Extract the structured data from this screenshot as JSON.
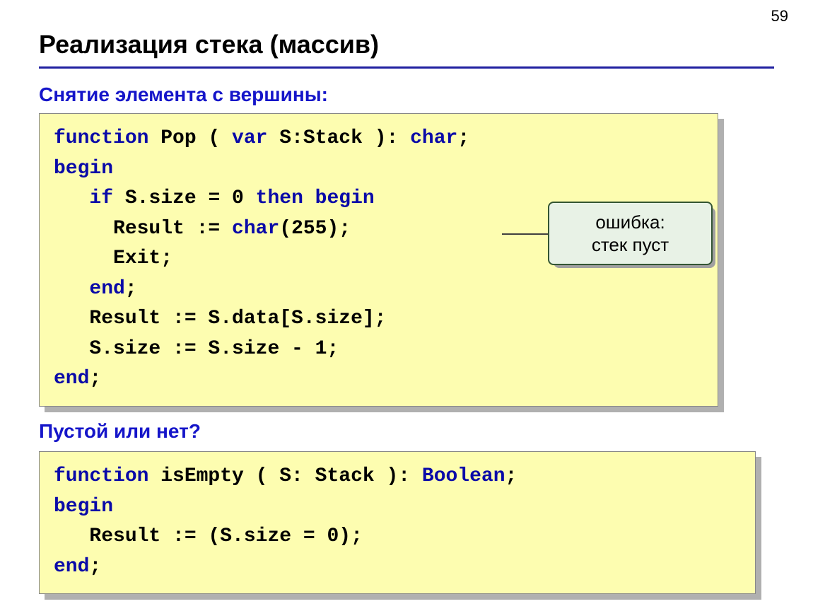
{
  "page_number": "59",
  "title": "Реализация стека (массив)",
  "subhead1": "Снятие элемента с вершины:",
  "subhead2": "Пустой или нет?",
  "callout": {
    "line1": "ошибка:",
    "line2": "стек пуст"
  },
  "code1": {
    "l1a": "function",
    "l1b": " Pop ( ",
    "l1c": "var",
    "l1d": " S:Stack ): ",
    "l1e": "char",
    "l1f": ";",
    "l2": "begin",
    "l3a": "   ",
    "l3b": "if",
    "l3c": " S.size = 0 ",
    "l3d": "then begin",
    "l4a": "     Result := ",
    "l4b": "char",
    "l4c": "(255);",
    "l5": "     Exit;",
    "l6a": "   ",
    "l6b": "end",
    "l6c": ";",
    "l7": "   Result := S.data[S.size];",
    "l8": "   S.size := S.size - 1;",
    "l9a": "end",
    "l9b": ";"
  },
  "code2": {
    "l1a": "function",
    "l1b": " isEmpty ( S: Stack ): ",
    "l1c": "Boolean",
    "l1d": ";",
    "l2": "begin",
    "l3": "   Result := (S.size = 0);",
    "l4a": "end",
    "l4b": ";"
  }
}
